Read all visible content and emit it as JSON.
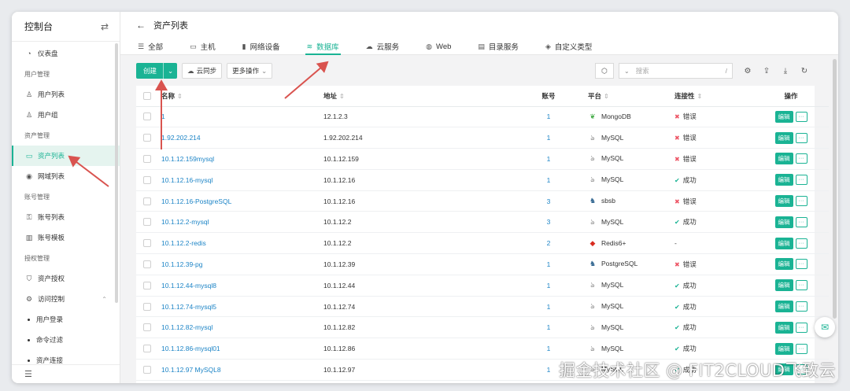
{
  "sidebar": {
    "title": "控制台",
    "swap_icon": "⇄",
    "dashboard": "仪表盘",
    "groups": {
      "user_mgmt": "用户管理",
      "asset_mgmt": "资产管理",
      "account_mgmt": "账号管理",
      "perm_mgmt": "授权管理"
    },
    "items": {
      "user_list": "用户列表",
      "user_group": "用户组",
      "asset_list": "资产列表",
      "domain_list": "网域列表",
      "account_list": "账号列表",
      "account_template": "账号模板",
      "asset_perm": "资产授权",
      "access_control": "访问控制"
    },
    "sub_items": [
      "用户登录",
      "命令过滤",
      "资产连接"
    ]
  },
  "header": {
    "title": "资产列表",
    "tabs": [
      "全部",
      "主机",
      "网络设备",
      "数据库",
      "云服务",
      "Web",
      "目录服务",
      "自定义类型"
    ],
    "active_tab": "数据库"
  },
  "toolbar": {
    "create": "创建",
    "sync": "云同步",
    "more": "更多操作",
    "search_placeholder": "搜索",
    "search_suffix": "/"
  },
  "table": {
    "columns": [
      "名称",
      "地址",
      "账号",
      "平台",
      "连接性",
      "操作"
    ],
    "edit_label": "编辑",
    "more_label": "···",
    "rows": [
      {
        "name": "1",
        "address": "12.1.2.3",
        "accounts": "1",
        "platform": "MongoDB",
        "status": "错误"
      },
      {
        "name": "1.92.202.214",
        "address": "1.92.202.214",
        "accounts": "1",
        "platform": "MySQL",
        "status": "错误"
      },
      {
        "name": "10.1.12.159mysql",
        "address": "10.1.12.159",
        "accounts": "1",
        "platform": "MySQL",
        "status": "错误"
      },
      {
        "name": "10.1.12.16-mysql",
        "address": "10.1.12.16",
        "accounts": "1",
        "platform": "MySQL",
        "status": "成功"
      },
      {
        "name": "10.1.12.16-PostgreSQL",
        "address": "10.1.12.16",
        "accounts": "3",
        "platform": "sbsb",
        "status": "错误"
      },
      {
        "name": "10.1.12.2-mysql",
        "address": "10.1.12.2",
        "accounts": "3",
        "platform": "MySQL",
        "status": "成功"
      },
      {
        "name": "10.1.12.2-redis",
        "address": "10.1.12.2",
        "accounts": "2",
        "platform": "Redis6+",
        "status": "-"
      },
      {
        "name": "10.1.12.39-pg",
        "address": "10.1.12.39",
        "accounts": "1",
        "platform": "PostgreSQL",
        "status": "错误"
      },
      {
        "name": "10.1.12.44-mysql8",
        "address": "10.1.12.44",
        "accounts": "1",
        "platform": "MySQL",
        "status": "成功"
      },
      {
        "name": "10.1.12.74-mysql5",
        "address": "10.1.12.74",
        "accounts": "1",
        "platform": "MySQL",
        "status": "成功"
      },
      {
        "name": "10.1.12.82-mysql",
        "address": "10.1.12.82",
        "accounts": "1",
        "platform": "MySQL",
        "status": "成功"
      },
      {
        "name": "10.1.12.86-mysql01",
        "address": "10.1.12.86",
        "accounts": "1",
        "platform": "MySQL",
        "status": "成功"
      },
      {
        "name": "10.1.12.97 MySQL8",
        "address": "10.1.12.97",
        "accounts": "1",
        "platform": "MySQL",
        "status": "成功"
      }
    ]
  },
  "colors": {
    "accent": "#1ab394",
    "link": "#1c84c6",
    "error": "#ed5565",
    "annotation": "#d9534f"
  },
  "watermark": "掘金技术社区 @ FIT2CLOUD飞致云"
}
